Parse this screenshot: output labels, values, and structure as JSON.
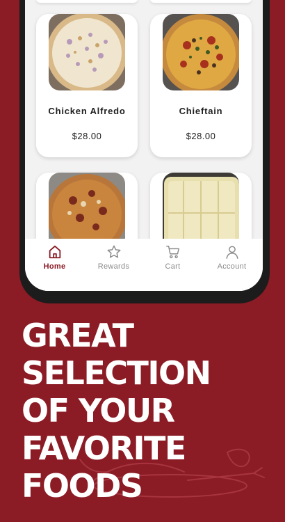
{
  "products": [
    {
      "name": "Chicken Alfredo",
      "price": "$28.00",
      "image": "pizza-photo"
    },
    {
      "name": "Chieftain",
      "price": "$28.00",
      "image": "pizza-photo"
    },
    {
      "name": "",
      "price": "",
      "image": "pizza-photo"
    },
    {
      "name": "",
      "price": "",
      "image": "breadsticks-photo"
    }
  ],
  "nav": [
    {
      "label": "Home",
      "icon": "home-icon",
      "active": true
    },
    {
      "label": "Rewards",
      "icon": "star-icon",
      "active": false
    },
    {
      "label": "Cart",
      "icon": "cart-icon",
      "active": false
    },
    {
      "label": "Account",
      "icon": "account-icon",
      "active": false
    }
  ],
  "headline": [
    "GREAT",
    "SELECTION",
    "OF YOUR",
    "FAVORITE",
    "FOODS"
  ],
  "colors": {
    "brand": "#8b1b24",
    "screen_bg": "#f3f2f2",
    "card_bg": "#ffffff",
    "nav_inactive": "#8a8a8a"
  }
}
